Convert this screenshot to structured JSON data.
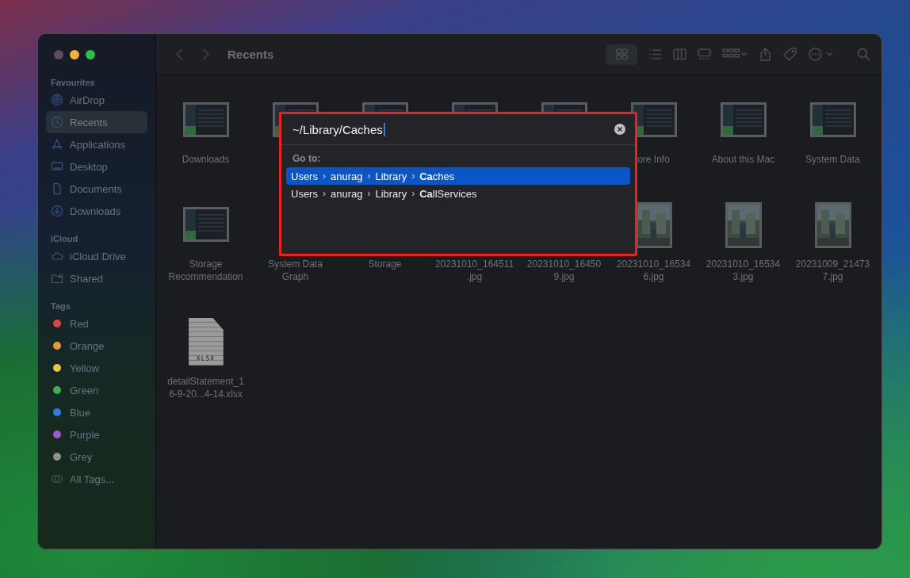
{
  "window": {
    "title": "Recents"
  },
  "sidebar": [
    {
      "heading": "Favourites",
      "items": [
        {
          "label": "AirDrop",
          "selected": false
        },
        {
          "label": "Recents",
          "selected": true
        },
        {
          "label": "Applications",
          "selected": false
        },
        {
          "label": "Desktop",
          "selected": false
        },
        {
          "label": "Documents",
          "selected": false
        },
        {
          "label": "Downloads",
          "selected": false
        }
      ]
    },
    {
      "heading": "iCloud",
      "items": [
        {
          "label": "iCloud Drive",
          "selected": false
        },
        {
          "label": "Shared",
          "selected": false
        }
      ]
    },
    {
      "heading": "Tags",
      "items": [
        {
          "label": "Red",
          "color": "#e0443e",
          "selected": false
        },
        {
          "label": "Orange",
          "color": "#f0962f",
          "selected": false
        },
        {
          "label": "Yellow",
          "color": "#e8c93a",
          "selected": false
        },
        {
          "label": "Green",
          "color": "#3fae4c",
          "selected": false
        },
        {
          "label": "Blue",
          "color": "#2f7de1",
          "selected": false
        },
        {
          "label": "Purple",
          "color": "#9a5bc8",
          "selected": false
        },
        {
          "label": "Grey",
          "color": "#8e8e93",
          "selected": false
        },
        {
          "label": "All Tags...",
          "selected": false
        }
      ]
    }
  ],
  "files": [
    {
      "kind": "screenshot",
      "lines": [
        "Downloads"
      ]
    },
    {
      "kind": "screenshot"
    },
    {
      "kind": "screenshot"
    },
    {
      "kind": "screenshot"
    },
    {
      "kind": "screenshot"
    },
    {
      "kind": "screenshot",
      "lines": [
        "ore Info"
      ]
    },
    {
      "kind": "screenshot",
      "lines": [
        "About this Mac"
      ]
    },
    {
      "kind": "screenshot",
      "lines": [
        "System Data"
      ]
    },
    {
      "kind": "screenshot",
      "lines": [
        "Storage",
        "Recommendation"
      ]
    },
    {
      "lines": [
        "System Data",
        "Graph"
      ]
    },
    {
      "lines": [
        "Storage"
      ]
    },
    {
      "lines": [
        "20231010_164511",
        ".jpg"
      ]
    },
    {
      "lines": [
        "20231010_16450",
        "9.jpg"
      ]
    },
    {
      "lines": [
        "20231010_16534",
        "6.jpg"
      ]
    },
    {
      "lines": [
        "20231010_16534",
        "3.jpg"
      ]
    },
    {
      "lines": [
        "20231009_21473",
        "7.jpg"
      ]
    },
    {
      "kind": "xlsx",
      "badge": "XLSX",
      "lines": [
        "detailStatement_1",
        "6-9-20...4-14.xlsx"
      ]
    }
  ],
  "go_to_folder": {
    "value": "~/Library/Caches",
    "heading": "Go to:",
    "separator": "›",
    "results": [
      {
        "path": [
          "Users",
          "anurag",
          "Library"
        ],
        "match": "Ca",
        "rest": "ches",
        "selected": true
      },
      {
        "path": [
          "Users",
          "anurag",
          "Library"
        ],
        "match": "Ca",
        "rest": "llServices",
        "selected": false
      }
    ]
  }
}
